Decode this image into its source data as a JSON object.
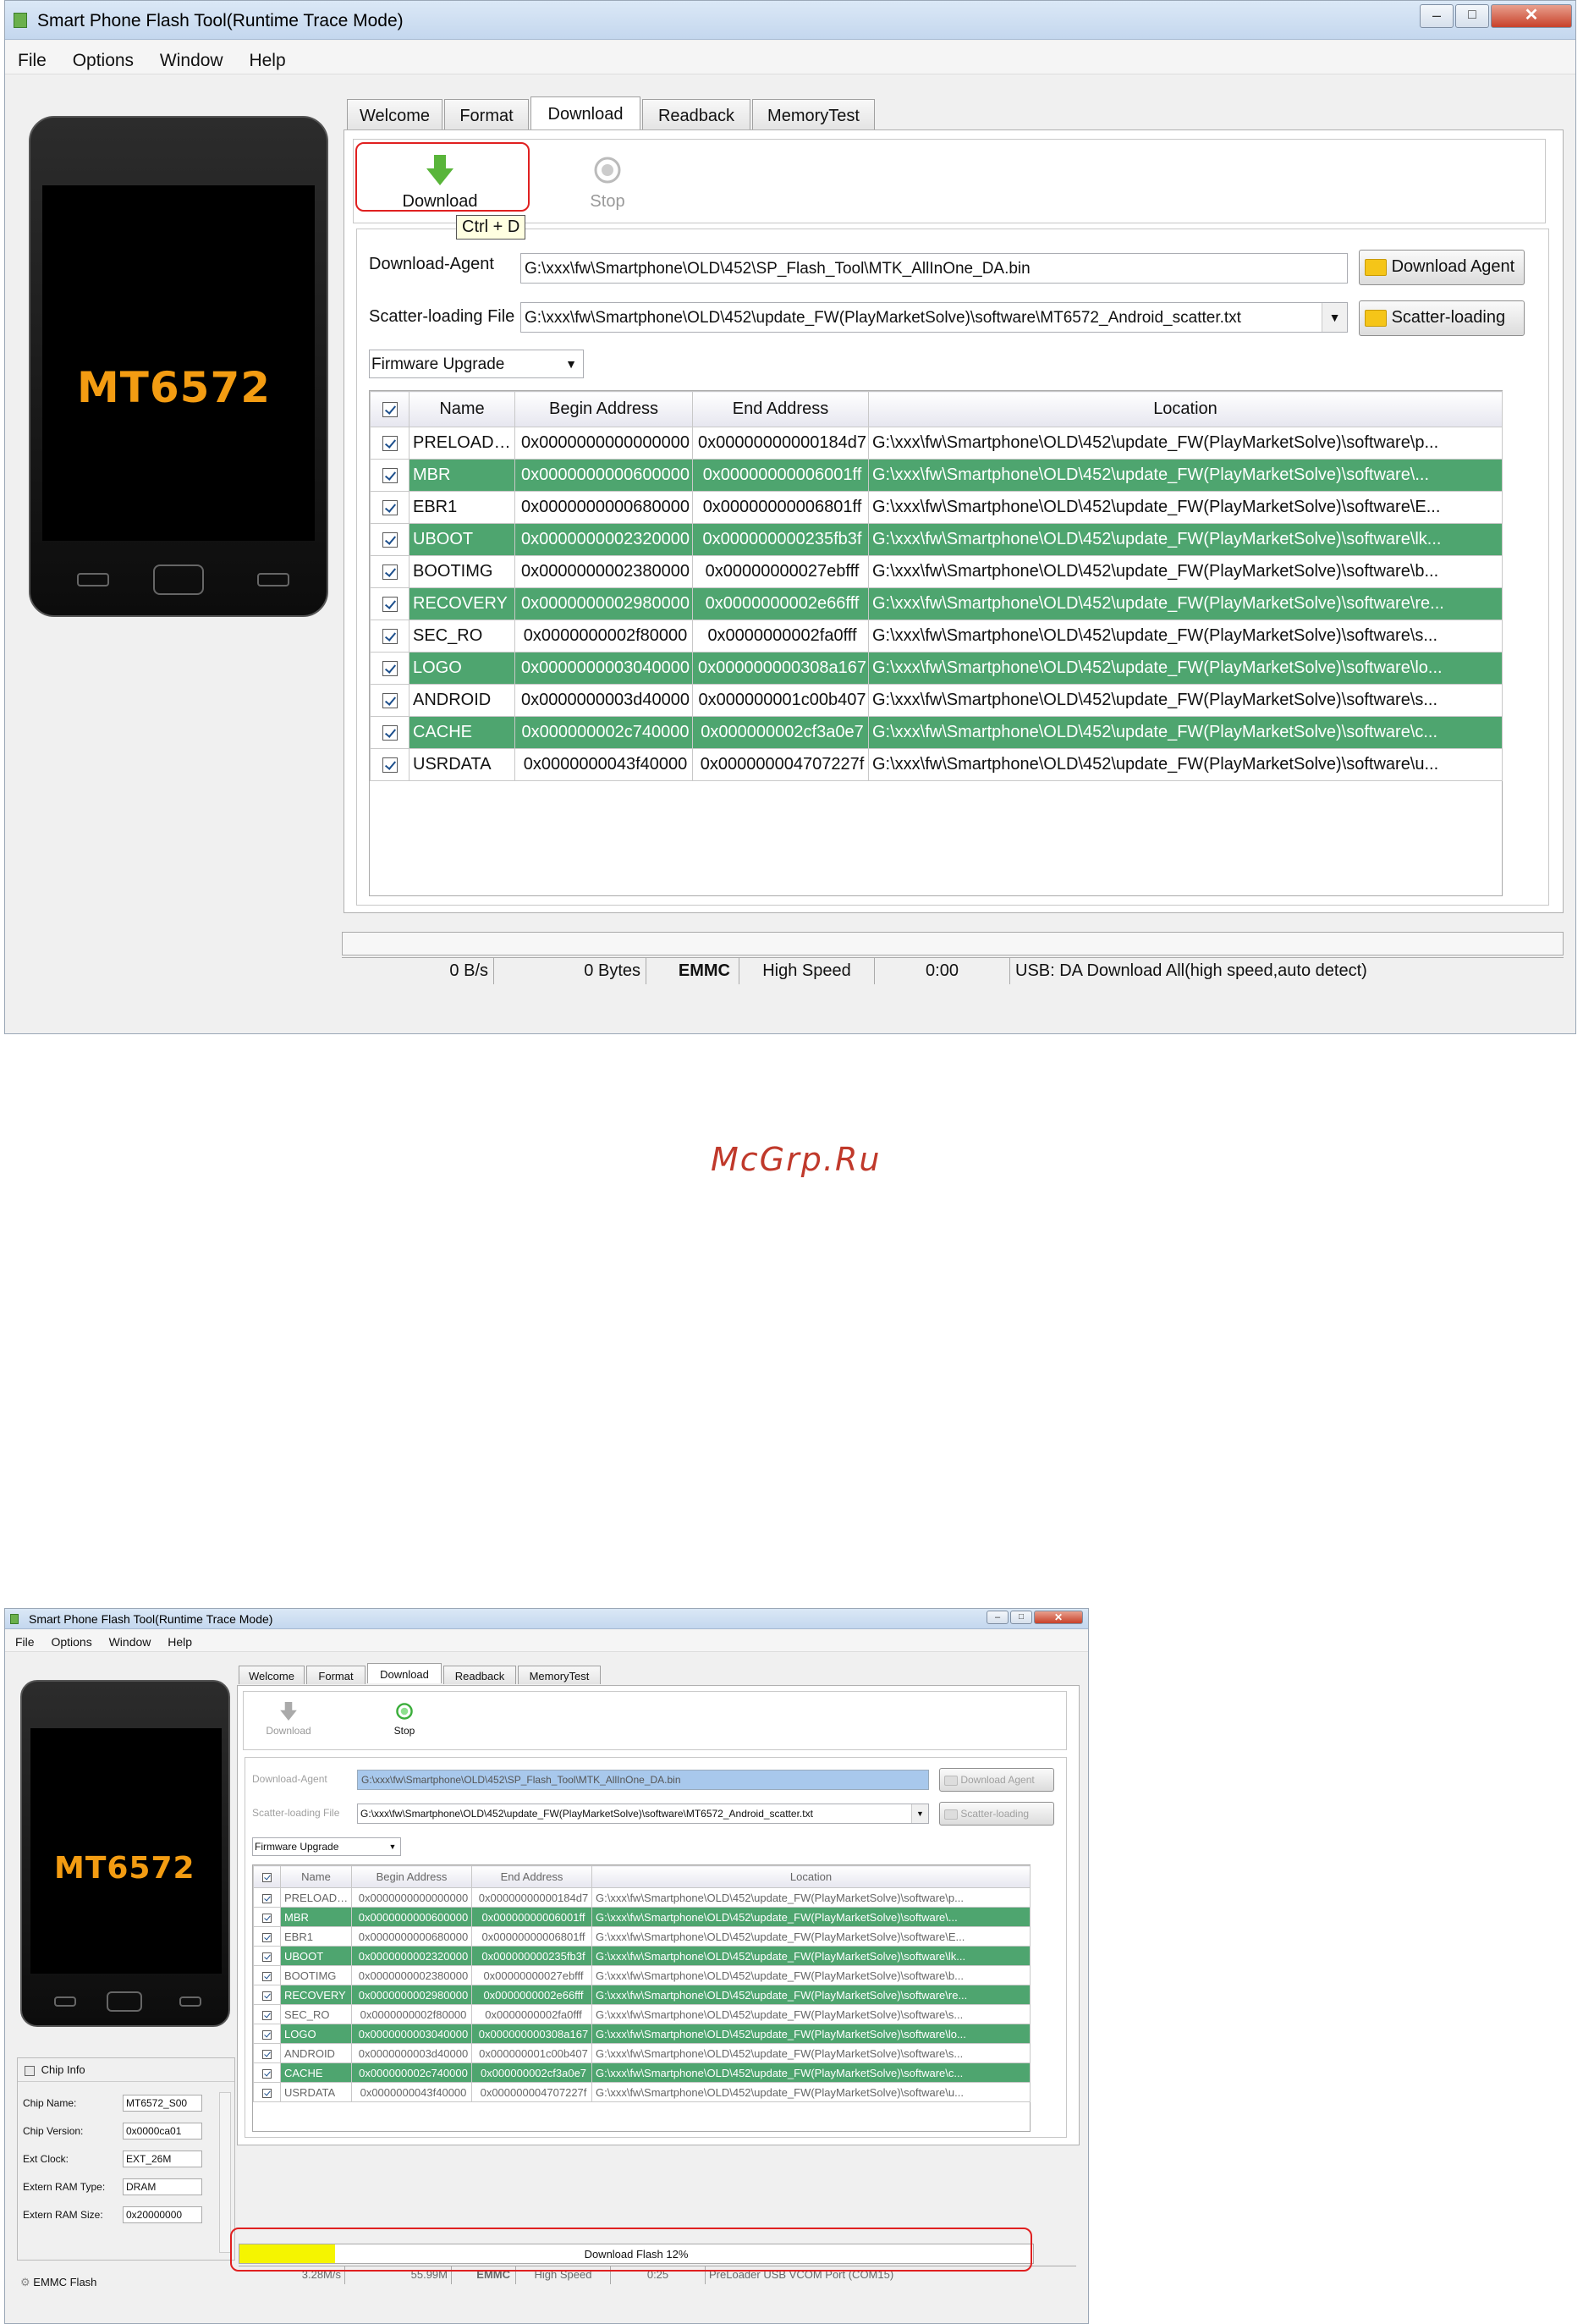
{
  "app_title": "Smart Phone Flash Tool(Runtime Trace Mode)",
  "menu": [
    "File",
    "Options",
    "Window",
    "Help"
  ],
  "phone_brand": "MT6572",
  "tabs": [
    "Welcome",
    "Format",
    "Download",
    "Readback",
    "MemoryTest"
  ],
  "toolbar": {
    "download_label": "Download",
    "stop_label": "Stop",
    "shortcut_tooltip": "Ctrl + D"
  },
  "download_agent": {
    "label": "Download-Agent",
    "value": "G:\\xxx\\fw\\Smartphone\\OLD\\452\\SP_Flash_Tool\\MTK_AllInOne_DA.bin",
    "button": "Download Agent"
  },
  "scatter": {
    "label": "Scatter-loading File",
    "value": "G:\\xxx\\fw\\Smartphone\\OLD\\452\\update_FW(PlayMarketSolve)\\software\\MT6572_Android_scatter.txt",
    "button": "Scatter-loading"
  },
  "mode_select": "Firmware Upgrade",
  "table": {
    "headers": [
      "Name",
      "Begin Address",
      "End Address",
      "Location"
    ],
    "rows": [
      {
        "name": "PRELOADER",
        "begin": "0x0000000000000000",
        "end": "0x00000000000184d7",
        "loc": "G:\\xxx\\fw\\Smartphone\\OLD\\452\\update_FW(PlayMarketSolve)\\software\\p..."
      },
      {
        "name": "MBR",
        "begin": "0x0000000000600000",
        "end": "0x00000000006001ff",
        "loc": "G:\\xxx\\fw\\Smartphone\\OLD\\452\\update_FW(PlayMarketSolve)\\software\\..."
      },
      {
        "name": "EBR1",
        "begin": "0x0000000000680000",
        "end": "0x00000000006801ff",
        "loc": "G:\\xxx\\fw\\Smartphone\\OLD\\452\\update_FW(PlayMarketSolve)\\software\\E..."
      },
      {
        "name": "UBOOT",
        "begin": "0x0000000002320000",
        "end": "0x000000000235fb3f",
        "loc": "G:\\xxx\\fw\\Smartphone\\OLD\\452\\update_FW(PlayMarketSolve)\\software\\lk..."
      },
      {
        "name": "BOOTIMG",
        "begin": "0x0000000002380000",
        "end": "0x00000000027ebfff",
        "loc": "G:\\xxx\\fw\\Smartphone\\OLD\\452\\update_FW(PlayMarketSolve)\\software\\b..."
      },
      {
        "name": "RECOVERY",
        "begin": "0x0000000002980000",
        "end": "0x0000000002e66fff",
        "loc": "G:\\xxx\\fw\\Smartphone\\OLD\\452\\update_FW(PlayMarketSolve)\\software\\re..."
      },
      {
        "name": "SEC_RO",
        "begin": "0x0000000002f80000",
        "end": "0x0000000002fa0fff",
        "loc": "G:\\xxx\\fw\\Smartphone\\OLD\\452\\update_FW(PlayMarketSolve)\\software\\s..."
      },
      {
        "name": "LOGO",
        "begin": "0x0000000003040000",
        "end": "0x000000000308a167",
        "loc": "G:\\xxx\\fw\\Smartphone\\OLD\\452\\update_FW(PlayMarketSolve)\\software\\lo..."
      },
      {
        "name": "ANDROID",
        "begin": "0x0000000003d40000",
        "end": "0x000000001c00b407",
        "loc": "G:\\xxx\\fw\\Smartphone\\OLD\\452\\update_FW(PlayMarketSolve)\\software\\s..."
      },
      {
        "name": "CACHE",
        "begin": "0x000000002c740000",
        "end": "0x000000002cf3a0e7",
        "loc": "G:\\xxx\\fw\\Smartphone\\OLD\\452\\update_FW(PlayMarketSolve)\\software\\c..."
      },
      {
        "name": "USRDATA",
        "begin": "0x0000000043f40000",
        "end": "0x000000004707227f",
        "loc": "G:\\xxx\\fw\\Smartphone\\OLD\\452\\update_FW(PlayMarketSolve)\\software\\u..."
      }
    ]
  },
  "status1": {
    "speed": "0 B/s",
    "bytes": "0 Bytes",
    "storage": "EMMC",
    "mode": "High Speed",
    "time": "0:00",
    "usb": "USB: DA Download All(high speed,auto detect)"
  },
  "watermark": "McGrp.Ru",
  "chip_info": {
    "title": "Chip Info",
    "fields": [
      {
        "label": "Chip Name:",
        "value": "MT6572_S00"
      },
      {
        "label": "Chip Version:",
        "value": "0x0000ca01"
      },
      {
        "label": "Ext Clock:",
        "value": "EXT_26M"
      },
      {
        "label": "Extern RAM Type:",
        "value": "DRAM"
      },
      {
        "label": "Extern RAM Size:",
        "value": "0x20000000"
      }
    ],
    "footer": "EMMC Flash"
  },
  "progress": {
    "label": "Download Flash 12%",
    "percent": 12,
    "color": "#f5f500"
  },
  "status2": {
    "speed": "3.28M/s",
    "bytes": "55.99M",
    "storage": "EMMC",
    "mode": "High Speed",
    "time": "0:25",
    "usb": "PreLoader USB VCOM Port (COM15)"
  },
  "colors": {
    "row_highlight": "#4ea56f",
    "annotation": "#e02020",
    "watermark": "#c0392b"
  }
}
